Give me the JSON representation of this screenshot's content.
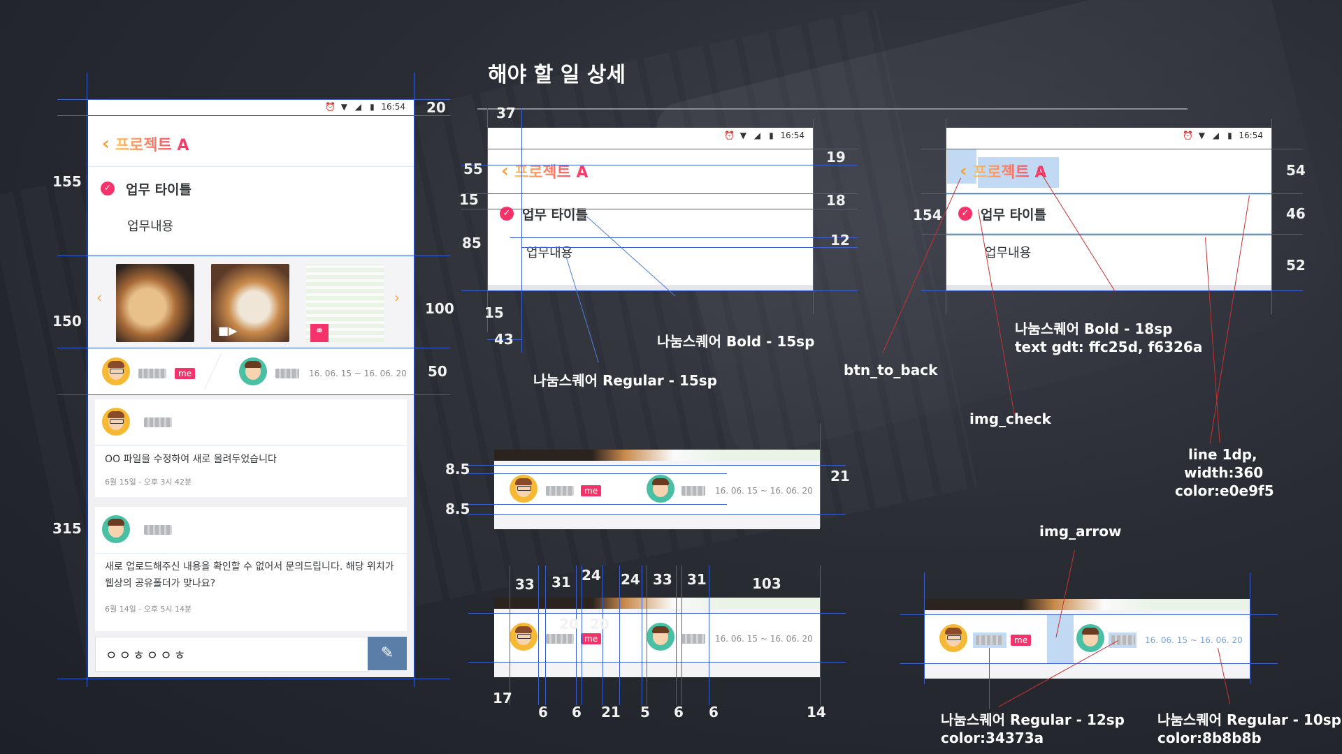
{
  "page_title": "해야 할 일 상세",
  "status_time": "16:54",
  "project_title": "프로젝트 A",
  "task_title": "업무 타이틀",
  "task_body": "업무내용",
  "me_label": "me",
  "date_range": "16. 06. 15 ~ 16. 06. 20",
  "comments": [
    {
      "text": "OO 파일을 수정하여 새로 올려두었습니다",
      "time": "6월 15일 - 오후 3시 42분"
    },
    {
      "text": "새로 업로드해주신 내용을 확인할 수 없어서 문의드립니다. 해당 위치가 웹상의 공유폴더가 맞나요?",
      "time": "6월 14일 - 오후 5시 14분"
    }
  ],
  "input_value": "ㅇㅇㅎㅇㅇㅎ",
  "colors": {
    "gradient_start": "#ffc25d",
    "gradient_end": "#f6326a",
    "text_main": "#34373a",
    "text_sub": "#8b8b8b",
    "line": "#e0e9f5",
    "guide": "#3a5fd0",
    "annotation_red": "#c8312f"
  },
  "annotations": {
    "regular15": "나눔스퀘어 Regular - 15sp",
    "bold15": "나눔스퀘어 Bold - 15sp",
    "bold18": "나눔스퀘어 Bold - 18sp",
    "text_gdt": "text gdt: ffc25d, f6326a",
    "btn_to_back": "btn_to_back",
    "img_check": "img_check",
    "line_spec_1": "line 1dp,",
    "line_spec_2": "width:360",
    "line_spec_3": "color:e0e9f5",
    "img_arrow": "img_arrow",
    "regular12": "나눔스퀘어 Regular - 12sp",
    "regular12_color": "color:34373a",
    "regular10": "나눔스퀘어 Regular - 10sp",
    "regular10_color": "color:8b8b8b"
  },
  "measurements": {
    "left_phone": {
      "m20": "20",
      "m155": "155",
      "m150": "150",
      "m100": "100",
      "m50": "50",
      "m315": "315"
    },
    "center_phone": {
      "m37": "37",
      "m55": "55",
      "m19": "19",
      "m15a": "15",
      "m18": "18",
      "m85": "85",
      "m12": "12",
      "m15b": "15",
      "m43": "43"
    },
    "right_phone": {
      "m54": "54",
      "m154": "154",
      "m46": "46",
      "m52": "52"
    },
    "member_row": {
      "m8_5a": "8.5",
      "m8_5b": "8.5",
      "m21": "21"
    },
    "spacing_row_top": [
      "33",
      "31",
      "24",
      "24",
      "33",
      "31",
      "103"
    ],
    "spacing_row_mid": [
      "20",
      "20"
    ],
    "spacing_row_bottom": [
      "17",
      "6",
      "6",
      "21",
      "5",
      "6",
      "6",
      "14"
    ]
  }
}
